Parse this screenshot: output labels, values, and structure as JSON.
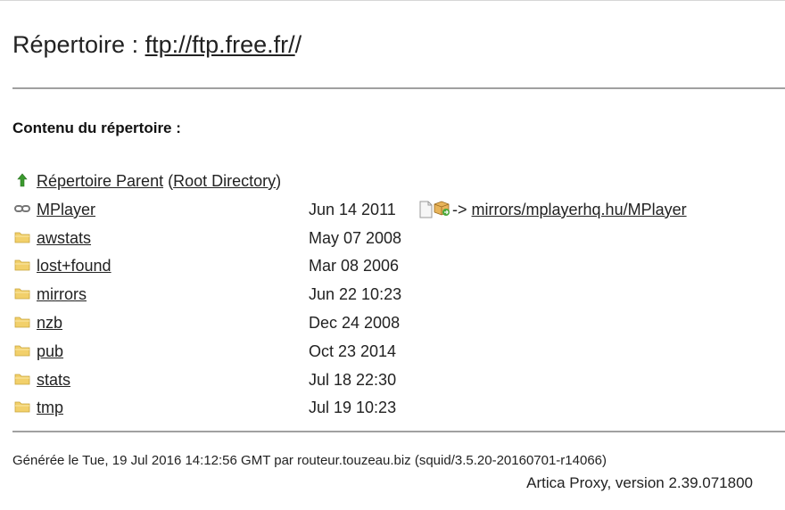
{
  "header": {
    "title_prefix": "Répertoire : ",
    "title_link": "ftp://ftp.free.fr/",
    "title_suffix": "/"
  },
  "subtitle": "Contenu du répertoire :",
  "parent": {
    "label": "Répertoire Parent",
    "open_paren": "(",
    "root_label": "Root Directory",
    "close_paren": ")",
    "icon": "arrow-up-icon"
  },
  "entries": [
    {
      "name": "MPlayer",
      "date": "Jun 14 2011",
      "icon": "link-icon",
      "arrow": "->",
      "target": "mirrors/mplayerhq.hu/MPlayer"
    },
    {
      "name": "awstats",
      "date": "May 07 2008",
      "icon": "folder-icon"
    },
    {
      "name": "lost+found",
      "date": "Mar 08 2006",
      "icon": "folder-icon"
    },
    {
      "name": "mirrors",
      "date": "Jun 22 10:23",
      "icon": "folder-icon"
    },
    {
      "name": "nzb",
      "date": "Dec 24 2008",
      "icon": "folder-icon"
    },
    {
      "name": "pub",
      "date": "Oct 23 2014",
      "icon": "folder-icon"
    },
    {
      "name": "stats",
      "date": "Jul 18 22:30",
      "icon": "folder-icon"
    },
    {
      "name": "tmp",
      "date": "Jul 19 10:23",
      "icon": "folder-icon"
    }
  ],
  "footer": {
    "generated": "Générée le Tue, 19 Jul 2016 14:12:56 GMT par routeur.touzeau.biz (squid/3.5.20-20160701-r14066)",
    "artica": "Artica Proxy, version 2.39.071800"
  },
  "colors": {
    "folder": "#f2d06b",
    "arrow": "#3a9a2e",
    "rule": "#a0a0a0"
  }
}
